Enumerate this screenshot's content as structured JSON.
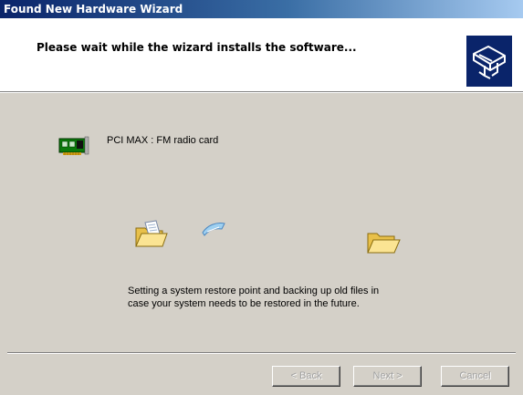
{
  "window": {
    "title": "Found New Hardware Wizard"
  },
  "header": {
    "heading": "Please wait while the wizard installs the software...",
    "icon": "hardware-wizard-icon"
  },
  "device": {
    "icon": "pci-card-icon",
    "name": "PCI MAX : FM radio card"
  },
  "animation": {
    "source_icon": "open-folder-icon",
    "moving_icon": "flying-document-icon",
    "target_icon": "folder-icon"
  },
  "status": {
    "line1": "Setting a system restore point and backing up old files in",
    "line2": "case your system needs to be restored in the future."
  },
  "buttons": {
    "back": "< Back",
    "next": "Next >",
    "cancel": "Cancel"
  },
  "colors": {
    "title_bar": "#0a246a",
    "dialog_bg": "#d4d0c8",
    "header_bg": "#ffffff",
    "disabled_text": "#a0a0a0"
  }
}
